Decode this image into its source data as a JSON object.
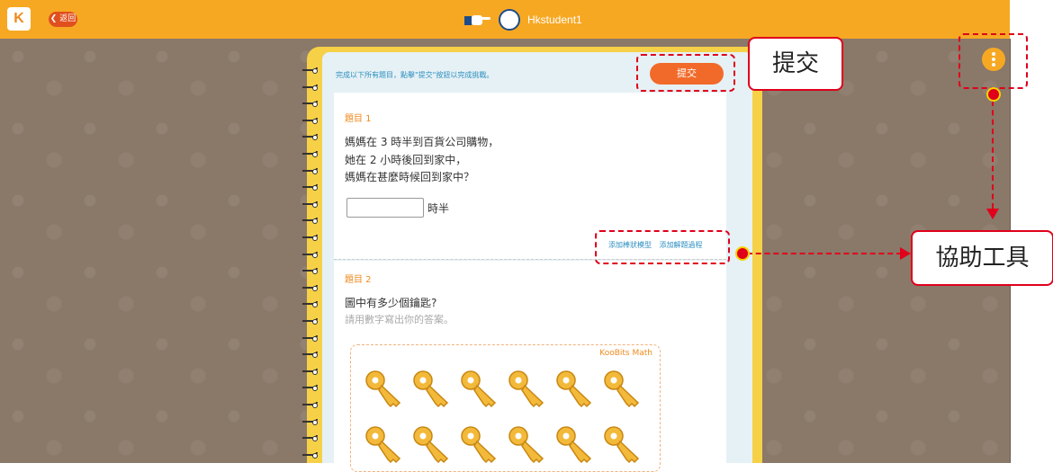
{
  "topbar": {
    "logo_text": "K",
    "back_label": "❮ 返回",
    "username": "Hkstudent1"
  },
  "page": {
    "instruction": "完成以下所有題目，點擊\"提交\"按鈕以完成挑戰。",
    "submit_label": "提交"
  },
  "question1": {
    "title": "題目 1",
    "lines": [
      "媽媽在 3 時半到百貨公司購物，",
      "她在 2 小時後回到家中，",
      "媽媽在甚麼時候回到家中？"
    ],
    "answer_value": "",
    "unit": "時半",
    "tools": [
      "添加棒狀模型",
      "添加解題過程"
    ]
  },
  "question2": {
    "title": "題目 2",
    "line": "圖中有多少個鑰匙?",
    "sub": "請用數字寫出你的答案。",
    "brand": "KooBits Math",
    "key_count": 12
  },
  "annotations": {
    "submit_callout": "提交",
    "tools_callout": "協助工具"
  },
  "colors": {
    "topbar": "#f7a823",
    "submit": "#f26a29",
    "highlight": "#e0001b",
    "link": "#2d8fc0"
  }
}
